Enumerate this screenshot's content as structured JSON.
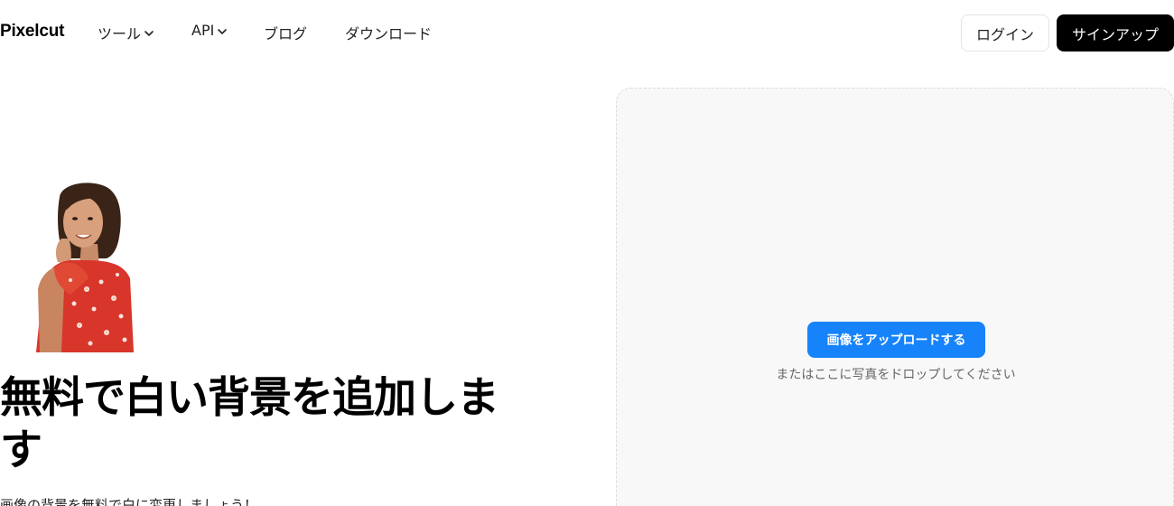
{
  "header": {
    "logo": "Pixelcut",
    "nav": [
      {
        "label": "ツール",
        "has_dropdown": true
      },
      {
        "label": "API",
        "has_dropdown": true
      },
      {
        "label": "ブログ",
        "has_dropdown": false
      },
      {
        "label": "ダウンロード",
        "has_dropdown": false
      }
    ],
    "login_label": "ログイン",
    "signup_label": "サインアップ"
  },
  "hero": {
    "title": "無料で白い背景を追加します",
    "subtitle": "画像の背景を無料で白に変更しましょう！",
    "image_icon": "person-cutout-image"
  },
  "upload": {
    "button_label": "画像をアップロードする",
    "hint": "またはここに写真をドロップしてください"
  },
  "colors": {
    "accent": "#1783fb",
    "signup_bg": "#000000",
    "panel_bg": "#f8f8f8"
  }
}
